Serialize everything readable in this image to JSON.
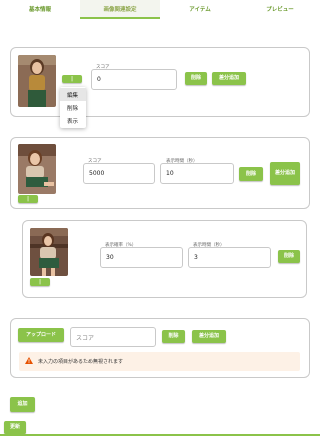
{
  "tabs": [
    {
      "label": "基本情報"
    },
    {
      "label": "画像関連設定"
    },
    {
      "label": "アイテム"
    },
    {
      "label": "プレビュー"
    }
  ],
  "card1": {
    "score_label": "スコア",
    "score_value": "0",
    "delete_label": "削除",
    "add_diff_label": "差分追加",
    "handle_label": "|",
    "menu": [
      {
        "label": "編集"
      },
      {
        "label": "削除"
      },
      {
        "label": "表示"
      }
    ]
  },
  "card2": {
    "score_label": "スコア",
    "score_value": "5000",
    "time_label": "表示時間（秒）",
    "time_value": "10",
    "delete_label": "削除",
    "add_diff_label": "差分追加",
    "handle_label": "|"
  },
  "card3": {
    "prob_label": "表示確率（%）",
    "prob_value": "30",
    "time_label": "表示時間（秒）",
    "time_value": "3",
    "delete_label": "削除",
    "handle_label": "|"
  },
  "card4": {
    "upload_label": "アップロード",
    "score_placeholder": "スコア",
    "delete_label": "削除",
    "add_diff_label": "差分追加",
    "warning_text": "未入力の項目があるため無視されます",
    "warning_icon": "warning-icon"
  },
  "add_label": "追加",
  "update_label": "更新",
  "colors": {
    "accent": "#8bc34a",
    "warning_bg": "#fdf1e6",
    "warning_icon": "#e65100"
  }
}
